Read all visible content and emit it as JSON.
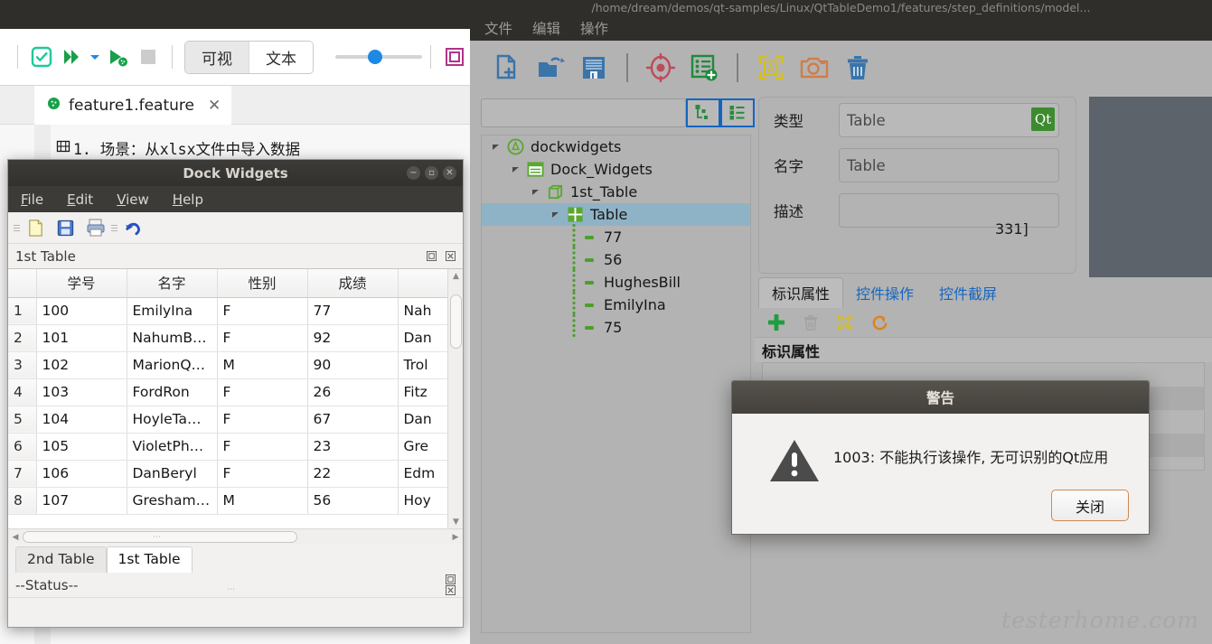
{
  "left_app": {
    "toolbar": {
      "icons": [
        "check-run-icon",
        "run-all-icon",
        "run-all-dropdown-icon",
        "run-cucumber-icon",
        "stop-icon",
        "grid-view-icon"
      ],
      "view_modes": [
        {
          "label": "可视",
          "active": true
        },
        {
          "label": "文本",
          "active": false
        }
      ],
      "zoom_slider_value": 40
    },
    "tab": {
      "label": "feature1.feature",
      "close": "✕",
      "icon": "cucumber-icon"
    },
    "editor": {
      "scenario_line": "1. 场景：从xlsx文件中导入数据",
      "scenario_icon": "film-strip-icon"
    }
  },
  "dock_window": {
    "title": "Dock Widgets",
    "window_buttons": [
      "−",
      "▫",
      "✕"
    ],
    "menus": [
      {
        "mnemonic": "F",
        "rest": "ile"
      },
      {
        "mnemonic": "E",
        "rest": "dit"
      },
      {
        "mnemonic": "V",
        "rest": "iew"
      },
      {
        "mnemonic": "H",
        "rest": "elp"
      }
    ],
    "toolbar_icons": [
      "new-document-icon",
      "save-icon",
      "print-icon",
      "undo-icon"
    ],
    "section_title": "1st Table",
    "dock_buttons": [
      "float-icon",
      "close-icon"
    ],
    "table": {
      "columns": [
        "",
        "学号",
        "名字",
        "性别",
        "成绩",
        ""
      ],
      "rows": [
        {
          "n": "1",
          "id": "100",
          "name": "EmilyIna",
          "sex": "F",
          "score": "77",
          "extra": "Nah"
        },
        {
          "n": "2",
          "id": "101",
          "name": "NahumB…",
          "sex": "F",
          "score": "92",
          "extra": "Dan"
        },
        {
          "n": "3",
          "id": "102",
          "name": "MarionQ…",
          "sex": "M",
          "score": "90",
          "extra": "Trol"
        },
        {
          "n": "4",
          "id": "103",
          "name": "FordRon",
          "sex": "F",
          "score": "26",
          "extra": "Fitz"
        },
        {
          "n": "5",
          "id": "104",
          "name": "HoyleTa…",
          "sex": "F",
          "score": "67",
          "extra": "Dan"
        },
        {
          "n": "6",
          "id": "105",
          "name": "VioletPh…",
          "sex": "F",
          "score": "23",
          "extra": "Gre"
        },
        {
          "n": "7",
          "id": "106",
          "name": "DanBeryl",
          "sex": "F",
          "score": "22",
          "extra": "Edm"
        },
        {
          "n": "8",
          "id": "107",
          "name": "Gresham…",
          "sex": "M",
          "score": "56",
          "extra": "Hoy"
        }
      ]
    },
    "tabs": [
      {
        "label": "2nd Table",
        "active": false
      },
      {
        "label": "1st Table",
        "active": true
      }
    ],
    "status": "--Status--",
    "status_buttons": [
      "float-icon",
      "close-icon"
    ]
  },
  "right_app": {
    "path": "/home/dream/demos/qt-samples/Linux/QtTableDemo1/features/step_definitions/model...",
    "menus": [
      "文件",
      "编辑",
      "操作"
    ],
    "toolbar_icons": [
      "new-file-icon",
      "open-folder-icon",
      "save-disk-icon",
      "target-locate-icon",
      "add-list-item-icon",
      "ocr-capture-icon",
      "camera-screenshot-icon",
      "trash-delete-icon"
    ],
    "tree": {
      "search_placeholder": "",
      "search_value": "",
      "buttons": [
        "collapse-tree-icon",
        "expand-tree-icon"
      ],
      "nodes": [
        {
          "label": "dockwidgets",
          "depth": 0,
          "icon": "app-icon",
          "expanded": true,
          "selected": false,
          "leaf": false
        },
        {
          "label": "Dock_Widgets",
          "depth": 1,
          "icon": "window-icon",
          "expanded": true,
          "selected": false,
          "leaf": false
        },
        {
          "label": "1st_Table",
          "depth": 2,
          "icon": "widget-icon",
          "expanded": true,
          "selected": false,
          "leaf": false
        },
        {
          "label": "Table",
          "depth": 3,
          "icon": "table-icon",
          "expanded": true,
          "selected": true,
          "leaf": false
        },
        {
          "label": "77",
          "depth": 4,
          "icon": "item-icon",
          "expanded": false,
          "selected": false,
          "leaf": true
        },
        {
          "label": "56",
          "depth": 4,
          "icon": "item-icon",
          "expanded": false,
          "selected": false,
          "leaf": true
        },
        {
          "label": "HughesBill",
          "depth": 4,
          "icon": "item-icon",
          "expanded": false,
          "selected": false,
          "leaf": true
        },
        {
          "label": "EmilyIna",
          "depth": 4,
          "icon": "item-icon",
          "expanded": false,
          "selected": false,
          "leaf": true
        },
        {
          "label": "75",
          "depth": 4,
          "icon": "item-icon",
          "expanded": false,
          "selected": false,
          "leaf": true
        }
      ]
    },
    "properties": {
      "type_label": "类型",
      "type_value": "Table",
      "type_badge": "Qt",
      "name_label": "名字",
      "name_value": "Table",
      "desc_label": "描述",
      "desc_value": "",
      "tabs": [
        {
          "label": "标识属性",
          "active": true
        },
        {
          "label": "控件操作",
          "active": false
        },
        {
          "label": "控件截屏",
          "active": false
        }
      ],
      "toolbar_icons": [
        "add-icon",
        "delete-icon",
        "locate-icon",
        "refresh-icon"
      ],
      "list_header": "标识属性",
      "behind_fragment": "331]"
    },
    "watermark": "testerhome.com"
  },
  "warning_dialog": {
    "title": "警告",
    "icon": "warning-triangle-icon",
    "message": "1003: 不能执行该操作, 无可识别的Qt应用",
    "close_button": "关闭"
  },
  "colors": {
    "accent_blue": "#1565c0",
    "green": "#3d8b2f",
    "selection": "#8fb3c6",
    "dark_chrome": "#2f2e2b",
    "panel_gray": "#b3b3b3"
  }
}
